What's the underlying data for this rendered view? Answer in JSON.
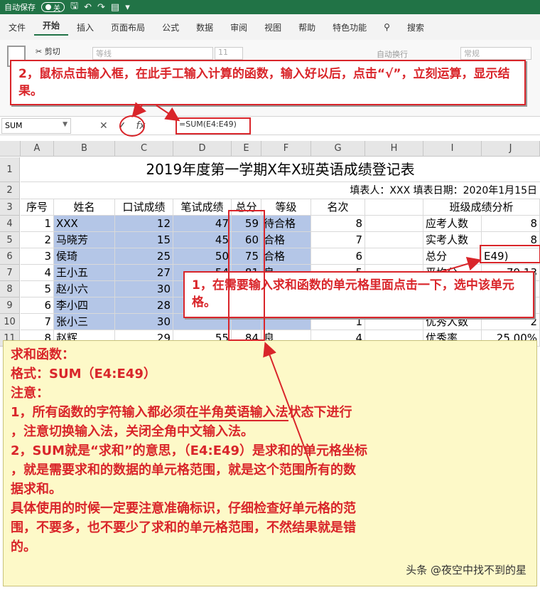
{
  "titlebar": {
    "autosave": "自动保存",
    "toggle": "关"
  },
  "menu": [
    "文件",
    "开始",
    "插入",
    "页面布局",
    "公式",
    "数据",
    "审阅",
    "视图",
    "帮助",
    "特色功能",
    "搜索"
  ],
  "ribbon": {
    "cut": "剪切",
    "font": "等线",
    "size": "11",
    "wrap": "自动换行",
    "normal": "常规"
  },
  "formula_bar": {
    "namebox": "SUM",
    "formula": "=SUM(E4:E49)"
  },
  "columns": [
    "A",
    "B",
    "C",
    "D",
    "E",
    "F",
    "G",
    "H",
    "I",
    "J"
  ],
  "rows": [
    "1",
    "2",
    "3",
    "4",
    "5",
    "6",
    "7",
    "8",
    "9",
    "10",
    "11"
  ],
  "sheet": {
    "title": "2019年度第一学期X年X班英语成绩登记表",
    "info": "填表人：XXX   填表日期：2020年1月15日",
    "headers": [
      "序号",
      "姓名",
      "口试成绩",
      "笔试成绩",
      "总分",
      "等级",
      "名次",
      "",
      "班级成绩分析"
    ],
    "data": [
      [
        "1",
        "XXX",
        "12",
        "47",
        "59",
        "待合格",
        "8"
      ],
      [
        "2",
        "马晓芳",
        "15",
        "45",
        "60",
        "合格",
        "7"
      ],
      [
        "3",
        "侯琦",
        "25",
        "50",
        "75",
        "合格",
        "6"
      ],
      [
        "4",
        "王小五",
        "27",
        "54",
        "81",
        "良",
        "5"
      ],
      [
        "5",
        "赵小六",
        "30",
        "",
        "",
        "",
        ""
      ],
      [
        "6",
        "李小四",
        "28",
        "",
        "",
        "",
        ""
      ],
      [
        "7",
        "张小三",
        "30",
        "",
        "",
        "",
        "1"
      ],
      [
        "8",
        "赵辉",
        "29",
        "55",
        "84",
        "良",
        "4"
      ]
    ],
    "analysis": [
      [
        "应考人数",
        "8"
      ],
      [
        "实考人数",
        "8"
      ],
      [
        "总分",
        "E49)"
      ],
      [
        "平均分",
        "79.13"
      ],
      [
        "",
        ""
      ],
      [
        "",
        ""
      ],
      [
        "优秀人数",
        "2"
      ],
      [
        "优秀率",
        "25.00%"
      ]
    ]
  },
  "callouts": {
    "top": "2，鼠标点击输入框，在此手工输入计算的函数，输入好以后，点击“√”，立刻运算，显示结果。",
    "mid": "1，在需要输入求和函数的单元格里面点击一下，选中该单元格。"
  },
  "note": {
    "l1": "求和函数：",
    "l2": "格式：SUM（E4:E49）",
    "l3": "注意：",
    "l4a": "1，所有函数的字符输入都必须在",
    "l4u": "半角英语输入法",
    "l4b": "状态下进行",
    "l5": "，注意切换输入法，关闭全角中文输入法。",
    "l6": "2，SUM就是“求和”的意思，（E4:E49）是求和的单元格坐标",
    "l7": "，就是需要求和的数据的单元格范围，就是这个范围所有的数",
    "l8": "据求和。",
    "l9": "具体使用的时候一定要注意准确标识，仔细检查好单元格的范",
    "l10": "围，不要多，也不要少了求和的单元格范围，不然结果就是错",
    "l11": "的。",
    "watermark": "头条 @夜空中找不到的星"
  },
  "colors": {
    "excel_green": "#217346",
    "red": "#d9252a",
    "selection": "#b4c6e7",
    "note_bg": "#fdf9c8"
  }
}
